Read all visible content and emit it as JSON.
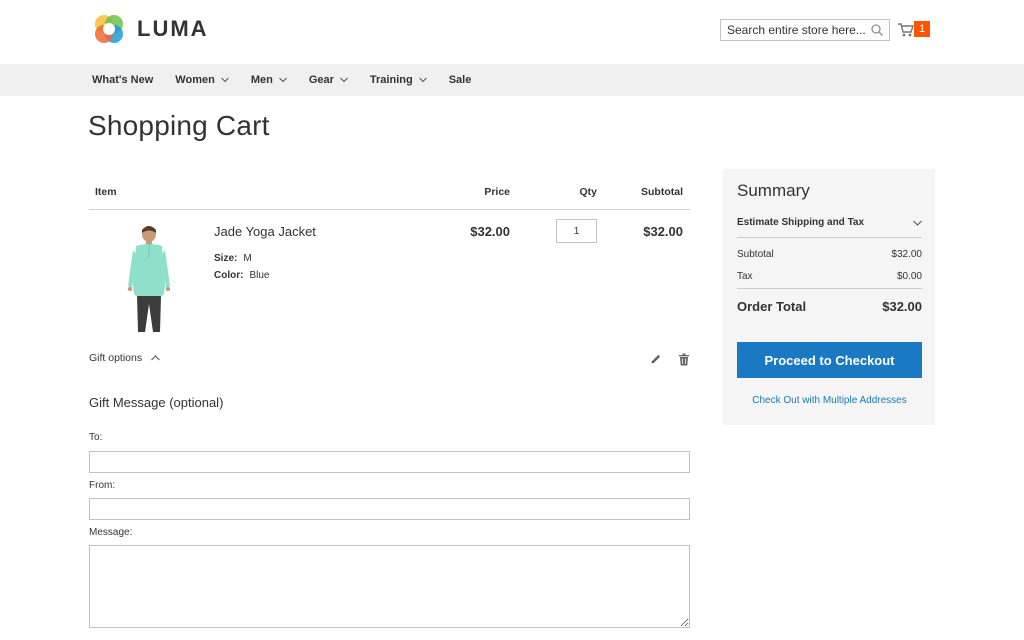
{
  "brand": {
    "name": "LUMA",
    "logo_icon": "luma-logo-icon"
  },
  "header": {
    "search": {
      "placeholder": "Search entire store here...",
      "icon": "search-icon"
    },
    "cart": {
      "icon": "cart-icon",
      "count": "1",
      "badge_color": "#ff5501"
    }
  },
  "nav": {
    "items": [
      {
        "label": "What's New",
        "has_dropdown": false
      },
      {
        "label": "Women",
        "has_dropdown": true
      },
      {
        "label": "Men",
        "has_dropdown": true
      },
      {
        "label": "Gear",
        "has_dropdown": true
      },
      {
        "label": "Training",
        "has_dropdown": true
      },
      {
        "label": "Sale",
        "has_dropdown": false
      }
    ]
  },
  "page": {
    "title": "Shopping Cart"
  },
  "cart_table": {
    "columns": {
      "item": "Item",
      "price": "Price",
      "qty": "Qty",
      "subtotal": "Subtotal"
    },
    "items": [
      {
        "name": "Jade Yoga Jacket",
        "options": [
          {
            "label": "Size:",
            "value": "M"
          },
          {
            "label": "Color:",
            "value": "Blue"
          }
        ],
        "price": "$32.00",
        "qty": "1",
        "subtotal": "$32.00",
        "product_color": "#8ee0cc"
      }
    ],
    "gift_options_label": "Gift options",
    "edit_icon": "pencil-icon",
    "delete_icon": "trash-icon"
  },
  "gift_message": {
    "title": "Gift Message (optional)",
    "to_label": "To:",
    "to_value": "",
    "from_label": "From:",
    "from_value": "",
    "message_label": "Message:",
    "message_value": ""
  },
  "summary": {
    "title": "Summary",
    "estimate_label": "Estimate Shipping and Tax",
    "subtotal_label": "Subtotal",
    "subtotal_value": "$32.00",
    "tax_label": "Tax",
    "tax_value": "$0.00",
    "order_total_label": "Order Total",
    "order_total_value": "$32.00",
    "checkout_label": "Proceed to Checkout",
    "multi_address_label": "Check Out with Multiple Addresses",
    "accent_color": "#1979c3"
  }
}
